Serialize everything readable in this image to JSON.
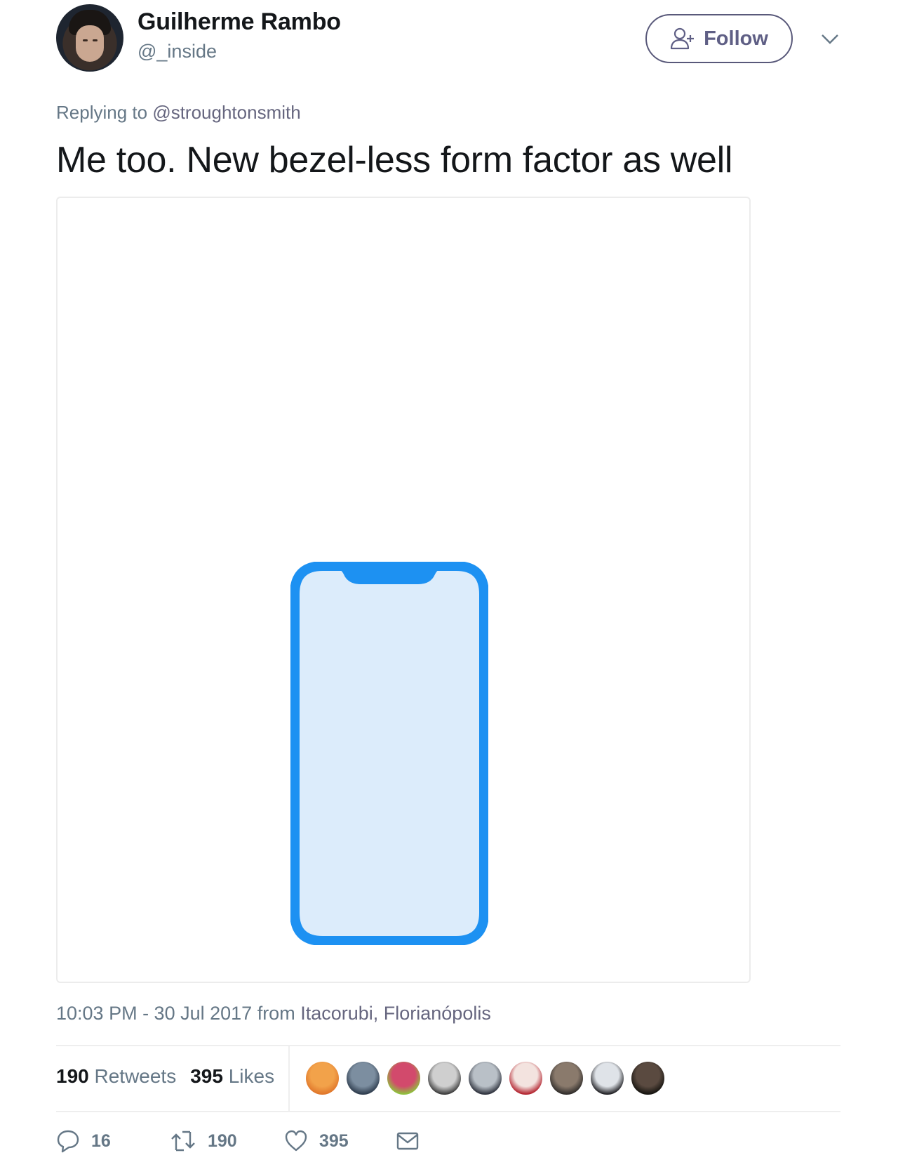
{
  "author": {
    "name": "Guilherme Rambo",
    "handle": "@_inside",
    "avatar_icon": "profile-photo"
  },
  "header": {
    "follow_label": "Follow",
    "follow_icon": "add-user-icon",
    "menu_icon": "chevron-down-icon"
  },
  "reply": {
    "prefix": "Replying to ",
    "mention": "@stroughtonsmith"
  },
  "tweet": {
    "text": "Me too. New bezel-less form factor as well",
    "media": {
      "description": "Blue outline of bezel-less phone with notch",
      "frame_color": "#1d91f2",
      "screen_color": "#dcecfb"
    }
  },
  "meta": {
    "time_date": "10:03 PM - 30 Jul 2017",
    "from": " from ",
    "place": "Itacorubi, Florianópolis"
  },
  "stats": {
    "retweets_count": "190",
    "retweets_label": " Retweets",
    "likes_count": "395",
    "likes_label": " Likes"
  },
  "likers": [
    {
      "name": "liker-orange",
      "colors": [
        "#f2a24a",
        "#e0762a"
      ]
    },
    {
      "name": "liker-2",
      "colors": [
        "#7c8ea0",
        "#2d3b4c"
      ]
    },
    {
      "name": "liker-3",
      "colors": [
        "#d24a6c",
        "#8dc43c"
      ]
    },
    {
      "name": "liker-4",
      "colors": [
        "#cfcfcf",
        "#3a3a3a"
      ]
    },
    {
      "name": "liker-5",
      "colors": [
        "#b9c0c7",
        "#2b2f3a"
      ]
    },
    {
      "name": "liker-6",
      "colors": [
        "#f3e3df",
        "#b2202c"
      ]
    },
    {
      "name": "liker-7",
      "colors": [
        "#8a7a6c",
        "#2f2c2a"
      ]
    },
    {
      "name": "liker-8",
      "colors": [
        "#dfe3e8",
        "#1e1e22"
      ]
    },
    {
      "name": "liker-9",
      "colors": [
        "#5a4a40",
        "#15130f"
      ]
    }
  ],
  "actions": {
    "reply_count": "16",
    "retweet_count": "190",
    "like_count": "395"
  },
  "colors": {
    "text_primary": "#14171a",
    "text_secondary": "#657786",
    "follow_border": "#59597a",
    "divider": "#eeeeee"
  }
}
